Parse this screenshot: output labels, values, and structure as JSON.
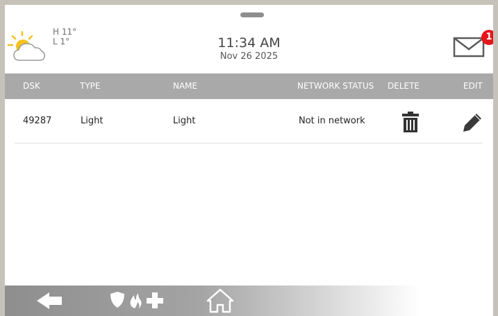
{
  "weather": {
    "high": "H 11°",
    "low": "L 1°",
    "icon": "partly-cloudy-icon"
  },
  "clock": {
    "time": "11:34 AM",
    "date": "Nov 26 2025"
  },
  "messages": {
    "icon": "envelope-icon",
    "unread_count": "1",
    "badge_color": "#e5161b"
  },
  "table": {
    "columns": [
      "DSK",
      "TYPE",
      "NAME",
      "NETWORK STATUS",
      "DELETE",
      "EDIT"
    ],
    "rows": [
      {
        "dsk": "49287",
        "type": "Light",
        "name": "Light",
        "network_status": "Not in network",
        "delete_icon": "trash-icon",
        "edit_icon": "pencil-icon"
      }
    ]
  },
  "footer": {
    "buttons": [
      "back-arrow-icon",
      "shield-icon",
      "fire-icon",
      "plus-icon",
      "home-icon"
    ]
  },
  "colors": {
    "header_bg": "#a9a9a9",
    "bezel": "#c7c2b9",
    "sun": "#f6c21b"
  }
}
